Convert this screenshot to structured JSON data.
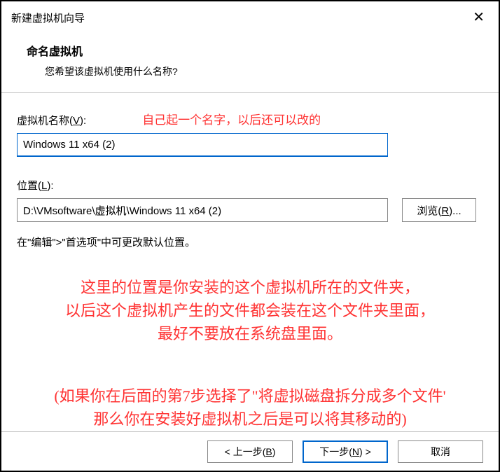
{
  "window": {
    "title": "新建虚拟机向导"
  },
  "header": {
    "title": "命名虚拟机",
    "description": "您希望该虚拟机使用什么名称?"
  },
  "name_field": {
    "label_pre": "虚拟机名称(",
    "label_key": "V",
    "label_post": "):",
    "annotation": "自己起一个名字，以后还可以改的",
    "value": "Windows 11 x64 (2)"
  },
  "location_field": {
    "label_pre": "位置(",
    "label_key": "L",
    "label_post": "):",
    "value": "D:\\VMsoftware\\虚拟机\\Windows 11 x64 (2)",
    "browse_pre": "浏览(",
    "browse_key": "R",
    "browse_post": ")..."
  },
  "note": "在\"编辑\">\"首选项\"中可更改默认位置。",
  "red1_line1": "这里的位置是你安装的这个虚拟机所在的文件夹，",
  "red1_line2": "以后这个虚拟机产生的文件都会装在这个文件夹里面，",
  "red1_line3": "最好不要放在系统盘里面。",
  "red2_line1": "(如果你在后面的第7步选择了\"将虚拟磁盘拆分成多个文件'",
  "red2_line2": "那么你在安装好虚拟机之后是可以将其移动的)",
  "buttons": {
    "back_pre": "< 上一步(",
    "back_key": "B",
    "back_post": ")",
    "next_pre": "下一步(",
    "next_key": "N",
    "next_post": ") >",
    "cancel": "取消"
  }
}
